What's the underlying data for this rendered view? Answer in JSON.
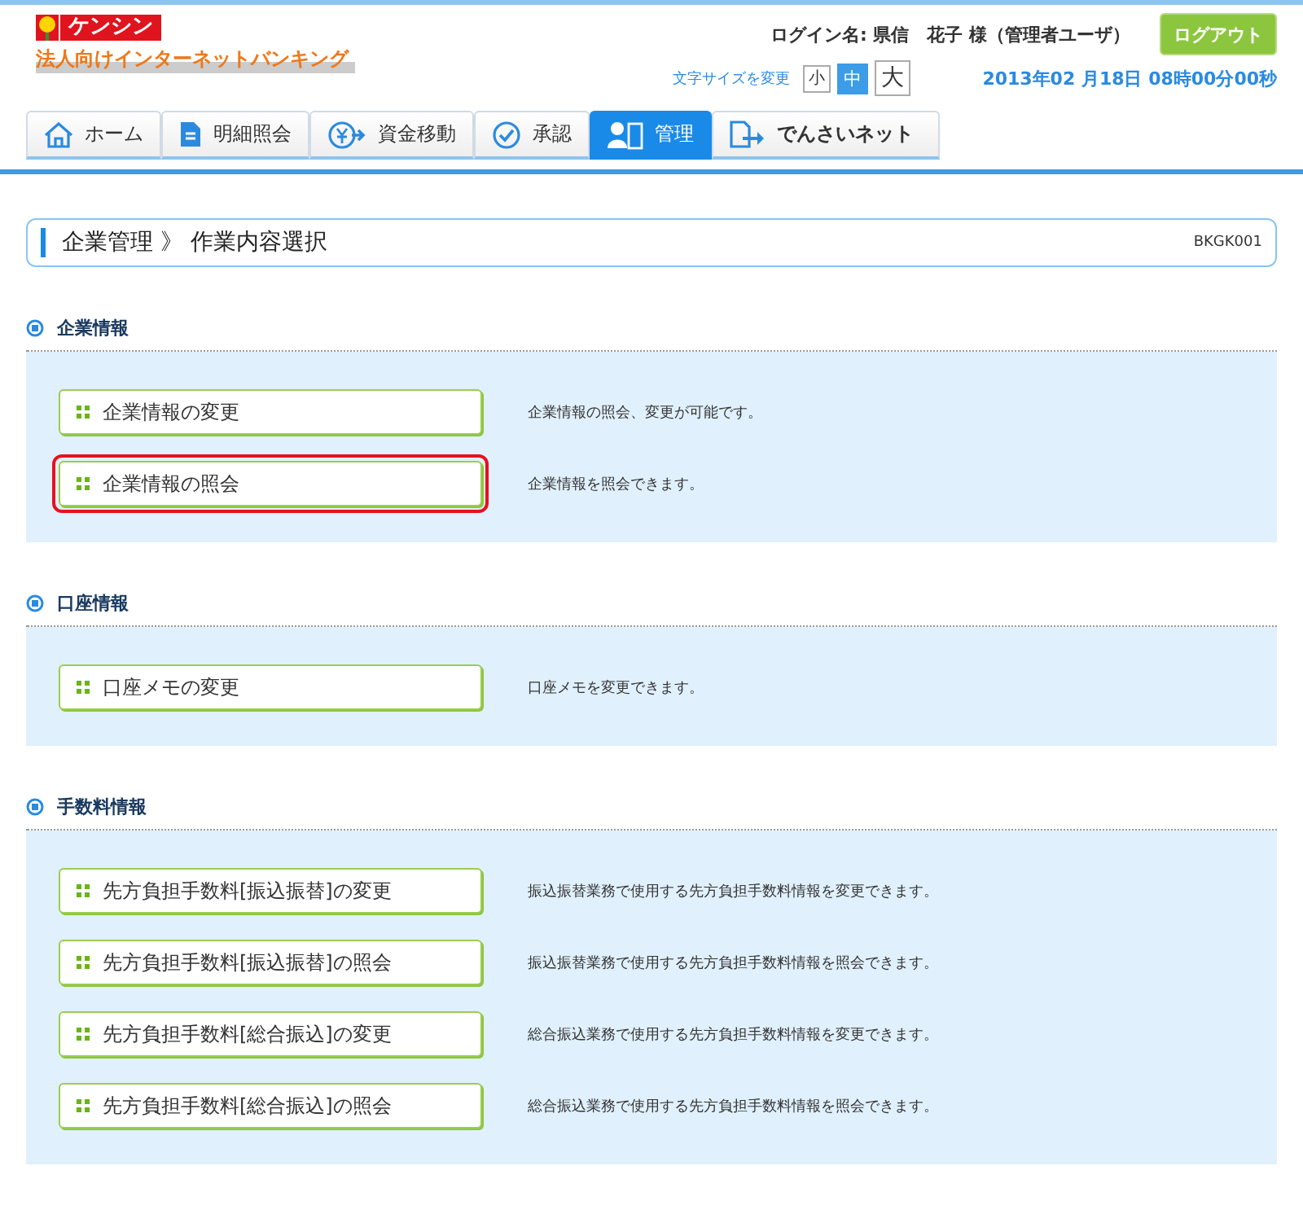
{
  "header": {
    "logo_text": "ケンシン",
    "logo_subtitle": "法人向けインターネットバンキング",
    "login_name": "ログイン名:  県信　花子 様（管理者ユーザ）",
    "logout_button": "ログアウト",
    "font_size_label": "文字サイズを変更",
    "font_sizes": [
      {
        "label": "小",
        "selected": false
      },
      {
        "label": "中",
        "selected": true
      },
      {
        "label": "大",
        "selected": false
      }
    ],
    "datetime": "2013年02 月18日  08時00分00秒"
  },
  "tabs": [
    {
      "label": "ホーム",
      "kind": "home",
      "selected": false
    },
    {
      "label": "明細照会",
      "kind": "document",
      "selected": false
    },
    {
      "label": "資金移動",
      "kind": "transfer",
      "selected": false
    },
    {
      "label": "承認",
      "kind": "check",
      "selected": false
    },
    {
      "label": "管理",
      "kind": "admin",
      "selected": true
    },
    {
      "label": "でんさいネット",
      "kind": "densai",
      "selected": false
    }
  ],
  "page_title": {
    "text": "企業管理 》 作業内容選択",
    "code": "BKGK001"
  },
  "sections": [
    {
      "title": "企業情報",
      "items": [
        {
          "label": "企業情報の変更",
          "description": "企業情報の照会、変更が可能です。",
          "highlighted": false
        },
        {
          "label": "企業情報の照会",
          "description": "企業情報を照会できます。",
          "highlighted": true
        }
      ]
    },
    {
      "title": "口座情報",
      "items": [
        {
          "label": "口座メモの変更",
          "description": "口座メモを変更できます。",
          "highlighted": false
        }
      ]
    },
    {
      "title": "手数料情報",
      "items": [
        {
          "label": "先方負担手数料[振込振替]の変更",
          "description": "振込振替業務で使用する先方負担手数料情報を変更できます。",
          "highlighted": false
        },
        {
          "label": "先方負担手数料[振込振替]の照会",
          "description": "振込振替業務で使用する先方負担手数料情報を照会できます。",
          "highlighted": false
        },
        {
          "label": "先方負担手数料[総合振込]の変更",
          "description": "総合振込業務で使用する先方負担手数料情報を変更できます。",
          "highlighted": false
        },
        {
          "label": "先方負担手数料[総合振込]の照会",
          "description": "総合振込業務で使用する先方負担手数料情報を照会できます。",
          "highlighted": false
        }
      ]
    }
  ]
}
